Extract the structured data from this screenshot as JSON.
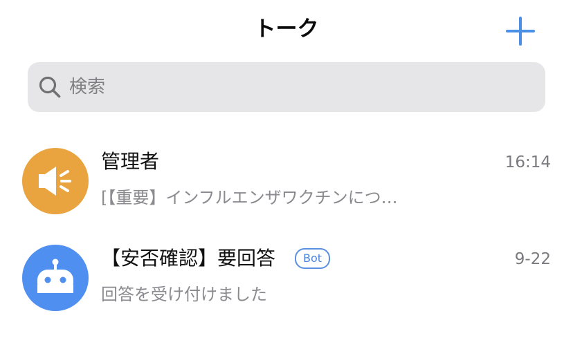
{
  "header": {
    "title": "トーク",
    "add_icon": "plus-icon"
  },
  "search": {
    "placeholder": "検索",
    "value": "",
    "icon": "search-icon"
  },
  "chats": [
    {
      "name": "管理者",
      "time": "16:14",
      "preview": "[【重要】インフルエンザワクチンにつ…",
      "avatar_icon": "megaphone-icon",
      "avatar_color": "#e9a43f",
      "badge": ""
    },
    {
      "name": "【安否確認】要回答",
      "time": "9-22",
      "preview": "回答を受け付けました",
      "avatar_icon": "robot-icon",
      "avatar_color": "#4f8ff0",
      "badge": "Bot"
    }
  ],
  "colors": {
    "accent": "#4a8fe8",
    "search_bg": "#e6e6e8"
  }
}
